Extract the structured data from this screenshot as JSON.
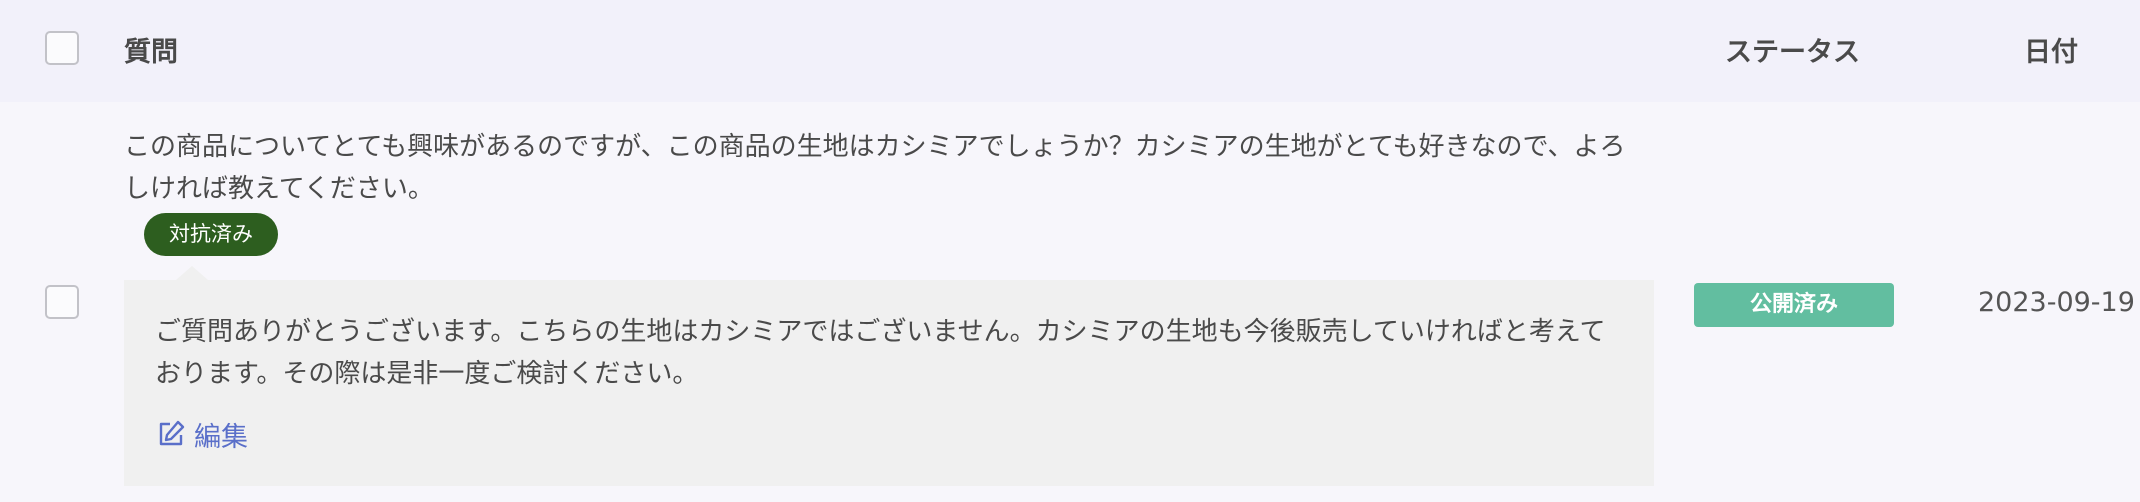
{
  "header": {
    "question_label": "質問",
    "status_label": "ステータス",
    "date_label": "日付"
  },
  "row": {
    "question": "この商品についてとても興味があるのですが、この商品の生地はカシミアでしょうか？カシミアの生地がとても好きなので、よろしければ教えてください。",
    "answered_badge": "対抗済み",
    "answer": "ご質問ありがとうございます。こちらの生地はカシミアではございません。カシミアの生地も今後販売していければと考えております。その際は是非一度ご検討ください。",
    "edit_label": "編集",
    "status": "公開済み",
    "date": "2023-09-19"
  },
  "colors": {
    "header_bg": "#f2f1fa",
    "answered_badge_bg": "#2d5e1f",
    "status_badge_bg": "#62bea0",
    "edit_link": "#5a6fc9"
  },
  "icons": {
    "edit": "edit-icon"
  }
}
